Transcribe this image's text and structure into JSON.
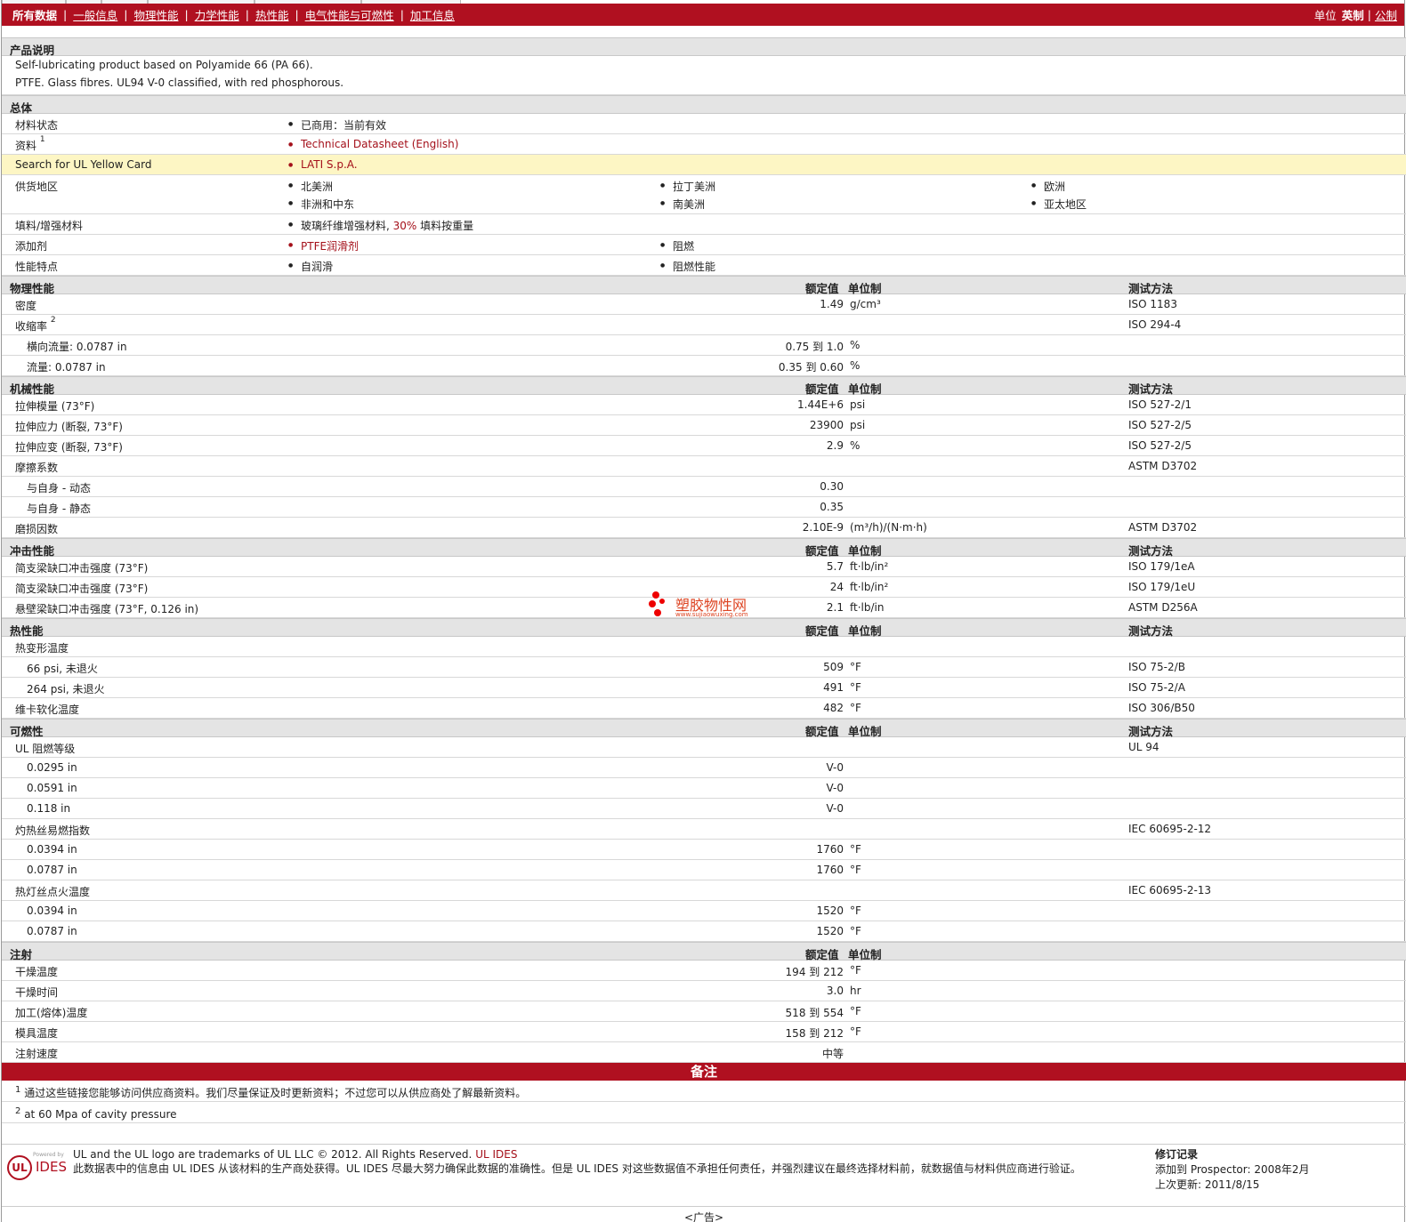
{
  "nav": {
    "current": "所有数据",
    "links": [
      "一般信息",
      "物理性能",
      "力学性能",
      "热性能",
      "电气性能与可燃性",
      "加工信息"
    ],
    "units_label": "单位",
    "unit_imperial": "英制",
    "unit_metric": "公制"
  },
  "headers": {
    "nominal": "额定值",
    "unit": "单位制",
    "method": "测试方法"
  },
  "description": {
    "title": "产品说明",
    "line1": "Self-lubricating product based on Polyamide 66 (PA 66).",
    "line2": "PTFE. Glass fibres. UL94 V-0 classified, with red phosphorous."
  },
  "general": {
    "title": "总体",
    "status_label": "材料状态",
    "status_value": "已商用：当前有效",
    "docs_label": "资料",
    "docs_sup": "1",
    "docs_value": "Technical Datasheet (English)",
    "ulcard_label": "Search for UL Yellow Card",
    "ulcard_value": "LATI S.p.A.",
    "regions_label": "供货地区",
    "regions": [
      "北美洲",
      "拉丁美洲",
      "欧洲",
      "非洲和中东",
      "南美洲",
      "亚太地区"
    ],
    "filler_label": "填料/增强材料",
    "filler_a": "玻璃纤维增强材料, ",
    "filler_b": "30%",
    "filler_c": " 填料按重量",
    "additive_label": "添加剂",
    "additive_1": "PTFE润滑剂",
    "additive_2": "阻燃",
    "feature_label": "性能特点",
    "feature_1": "自润滑",
    "feature_2": "阻燃性能"
  },
  "physical": {
    "title": "物理性能",
    "rows": [
      {
        "label": "密度",
        "value": "1.49",
        "unit": "g/cm³",
        "method": "ISO 1183"
      },
      {
        "label": "收缩率",
        "sup": "2",
        "value": "",
        "unit": "",
        "method": "ISO 294-4"
      },
      {
        "label": "横向流量: 0.0787 in",
        "value": "0.75 到  1.0",
        "unit": "%",
        "method": ""
      },
      {
        "label": "流量: 0.0787 in",
        "value": "0.35 到  0.60",
        "unit": "%",
        "method": ""
      }
    ]
  },
  "mechanical": {
    "title": "机械性能",
    "rows": [
      {
        "label": "拉伸模量 (73°F)",
        "value": "1.44E+6",
        "unit": "psi",
        "method": "ISO 527-2/1"
      },
      {
        "label": "拉伸应力 (断裂, 73°F)",
        "value": "23900",
        "unit": "psi",
        "method": "ISO 527-2/5"
      },
      {
        "label": "拉伸应变 (断裂, 73°F)",
        "value": "2.9",
        "unit": "%",
        "method": "ISO 527-2/5"
      },
      {
        "label": "摩擦系数",
        "value": "",
        "unit": "",
        "method": "ASTM D3702"
      },
      {
        "label": "与自身 - 动态",
        "value": "0.30",
        "unit": "",
        "method": ""
      },
      {
        "label": "与自身 - 静态",
        "value": "0.35",
        "unit": "",
        "method": ""
      },
      {
        "label": "磨损因数",
        "value": "2.10E-9",
        "unit": "(m³/h)/(N·m·h)",
        "method": "ASTM D3702"
      }
    ]
  },
  "impact": {
    "title": "冲击性能",
    "rows": [
      {
        "label": "简支梁缺口冲击强度 (73°F)",
        "value": "5.7",
        "unit": "ft·lb/in²",
        "method": "ISO 179/1eA"
      },
      {
        "label": "简支梁缺口冲击强度 (73°F)",
        "value": "24",
        "unit": "ft·lb/in²",
        "method": "ISO 179/1eU"
      },
      {
        "label": "悬壁梁缺口冲击强度 (73°F, 0.126 in)",
        "value": "2.1",
        "unit": "ft·lb/in",
        "method": "ASTM D256A"
      }
    ]
  },
  "thermal": {
    "title": "热性能",
    "rows": [
      {
        "label": "热变形温度",
        "value": "",
        "unit": "",
        "method": ""
      },
      {
        "label": "66 psi, 未退火",
        "value": "509",
        "unit": "°F",
        "method": "ISO 75-2/B"
      },
      {
        "label": "264 psi, 未退火",
        "value": "491",
        "unit": "°F",
        "method": "ISO 75-2/A"
      },
      {
        "label": "维卡软化温度",
        "value": "482",
        "unit": "°F",
        "method": "ISO 306/B50"
      }
    ]
  },
  "flammability": {
    "title": "可燃性",
    "rows": [
      {
        "label": "UL 阻燃等级",
        "value": "",
        "unit": "",
        "method": "UL 94"
      },
      {
        "label": "0.0295 in",
        "value": "V-0",
        "unit": "",
        "method": ""
      },
      {
        "label": "0.0591 in",
        "value": "V-0",
        "unit": "",
        "method": ""
      },
      {
        "label": "0.118 in",
        "value": "V-0",
        "unit": "",
        "method": ""
      },
      {
        "label": "灼热丝易燃指数",
        "value": "",
        "unit": "",
        "method": "IEC 60695-2-12"
      },
      {
        "label": "0.0394 in",
        "value": "1760",
        "unit": "°F",
        "method": ""
      },
      {
        "label": "0.0787 in",
        "value": "1760",
        "unit": "°F",
        "method": ""
      },
      {
        "label": "热灯丝点火温度",
        "value": "",
        "unit": "",
        "method": "IEC 60695-2-13"
      },
      {
        "label": "0.0394 in",
        "value": "1520",
        "unit": "°F",
        "method": ""
      },
      {
        "label": "0.0787 in",
        "value": "1520",
        "unit": "°F",
        "method": ""
      }
    ]
  },
  "injection": {
    "title": "注射",
    "rows": [
      {
        "label": "干燥温度",
        "value": "194 到  212",
        "unit": "°F",
        "method": ""
      },
      {
        "label": "干燥时间",
        "value": "3.0",
        "unit": "hr",
        "method": ""
      },
      {
        "label": "加工(熔体)温度",
        "value": "518 到  554",
        "unit": "°F",
        "method": ""
      },
      {
        "label": "模具温度",
        "value": "158 到  212",
        "unit": "°F",
        "method": ""
      },
      {
        "label": "注射速度",
        "value": "中等",
        "unit": "",
        "method": ""
      }
    ]
  },
  "notes": {
    "title": "备注",
    "n1_sup": "1",
    "n1": "通过这些链接您能够访问供应商资料。我们尽量保证及时更新资料；不过您可以从供应商处了解最新资料。",
    "n2_sup": "2",
    "n2": "at 60 Mpa of cavity pressure"
  },
  "footer": {
    "logo_ul": "UL",
    "logo_powered": "Powered by",
    "logo_ides": "IDES",
    "line1": "UL and the UL logo are trademarks of UL LLC © 2012. All Rights Reserved.",
    "line1_link": "UL IDES",
    "line2": "此数据表中的信息由  UL IDES 从该材料的生产商处获得。UL IDES 尽最大努力确保此数据的准确性。但是  UL IDES 对这些数据值不承担任何责任，并强烈建议在最终选择材料前，就数据值与材料供应商进行验证。",
    "rev_title": "修订记录",
    "rev_added": "添加到  Prospector:    2008年2月",
    "rev_updated": "上次更新:    2011/8/15"
  },
  "ad": "<广告>",
  "watermark": {
    "title": "塑胶物性网",
    "url": "www.sujiaowuxing.com"
  },
  "colors": {
    "brand": "#b01020",
    "highlight": "#fdf6c4",
    "section": "#e4e4e4"
  }
}
